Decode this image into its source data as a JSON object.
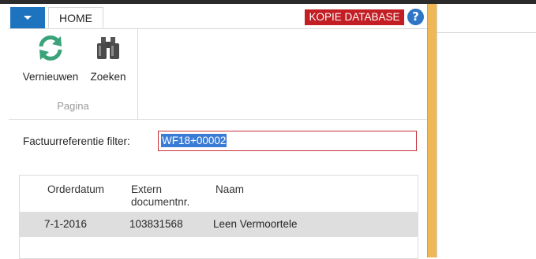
{
  "ribbon": {
    "tab_home": "HOME",
    "badge": "KOPIE DATABASE",
    "help": "?",
    "actions": [
      {
        "label": "Vernieuwen",
        "icon": "refresh-icon"
      },
      {
        "label": "Zoeken",
        "icon": "binoculars-icon"
      }
    ],
    "group_label": "Pagina"
  },
  "filter": {
    "label": "Factuurreferentie filter:",
    "value": "WF18+00002"
  },
  "table": {
    "columns": [
      "Orderdatum",
      "Extern documentnr.",
      "Naam"
    ],
    "rows": [
      [
        "7-1-2016",
        "103831568",
        "Leen Vermoortele"
      ]
    ]
  },
  "colors": {
    "accent": "#1e73be",
    "badge": "#c21e24",
    "splitter": "#f0b755",
    "refresh": "#3aa37a"
  }
}
